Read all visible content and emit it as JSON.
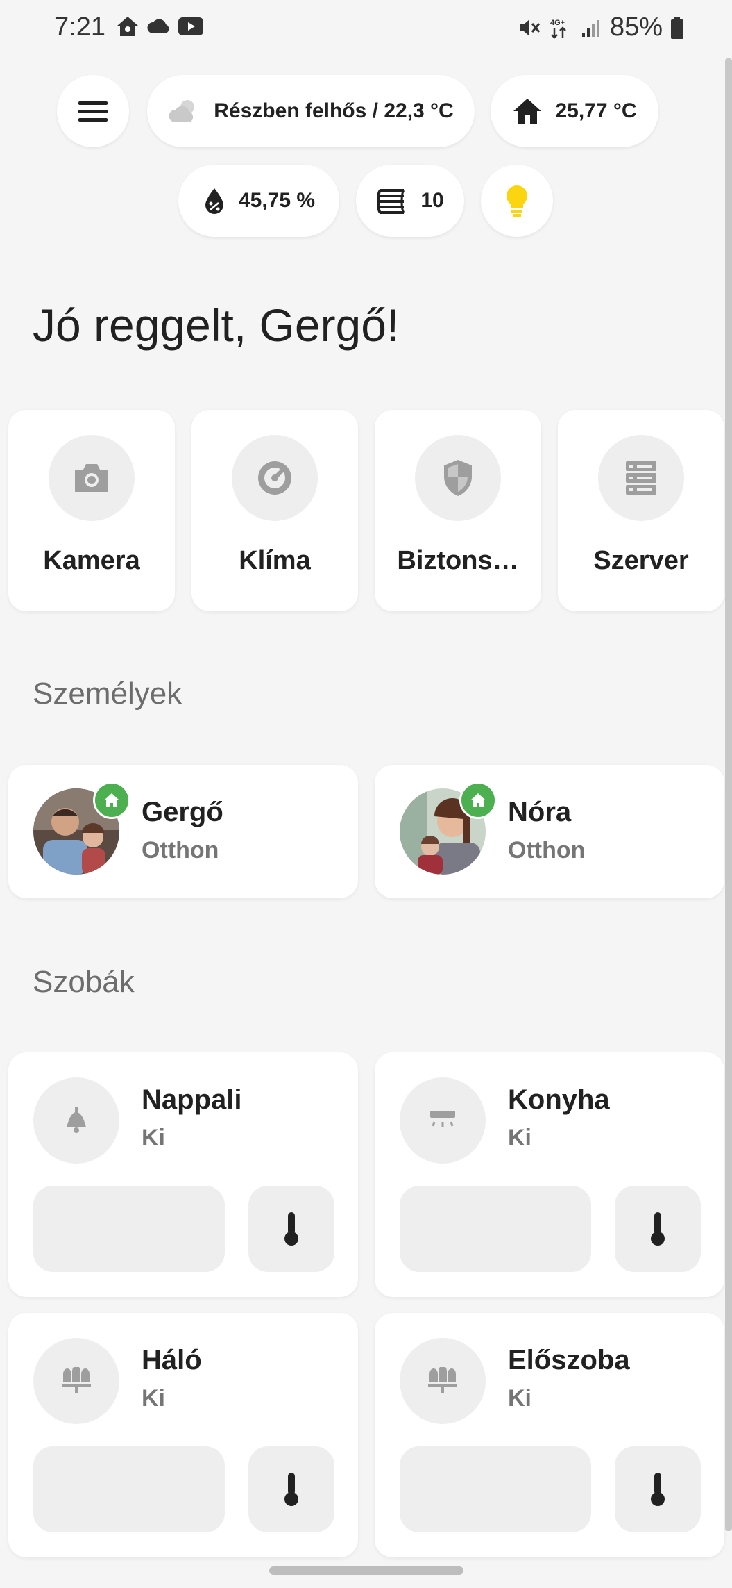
{
  "status_bar": {
    "time": "7:21",
    "battery": "85%",
    "network": "4G+"
  },
  "chips": {
    "weather": "Részben felhős / 22,3 °C",
    "indoor_temp": "25,77 °C",
    "humidity": "45,75 %",
    "radiator": "10"
  },
  "greeting": "Jó reggelt, Gergő!",
  "shortcuts": [
    {
      "label": "Kamera",
      "icon": "camera-icon"
    },
    {
      "label": "Klíma",
      "icon": "climate-icon"
    },
    {
      "label": "Biztons…",
      "icon": "shield-icon"
    },
    {
      "label": "Szerver",
      "icon": "server-icon"
    }
  ],
  "sections": {
    "people": "Személyek",
    "rooms": "Szobák"
  },
  "people": [
    {
      "name": "Gergő",
      "state": "Otthon"
    },
    {
      "name": "Nóra",
      "state": "Otthon"
    }
  ],
  "rooms": [
    {
      "name": "Nappali",
      "state": "Ki",
      "icon": "ceiling-lamp-icon"
    },
    {
      "name": "Konyha",
      "state": "Ki",
      "icon": "led-strip-icon"
    },
    {
      "name": "Háló",
      "state": "Ki",
      "icon": "chandelier-icon"
    },
    {
      "name": "Előszoba",
      "state": "Ki",
      "icon": "chandelier-icon"
    }
  ],
  "colors": {
    "accent_yellow": "#fbd50f",
    "home_green": "#4caf50",
    "background": "#f5f5f5"
  }
}
